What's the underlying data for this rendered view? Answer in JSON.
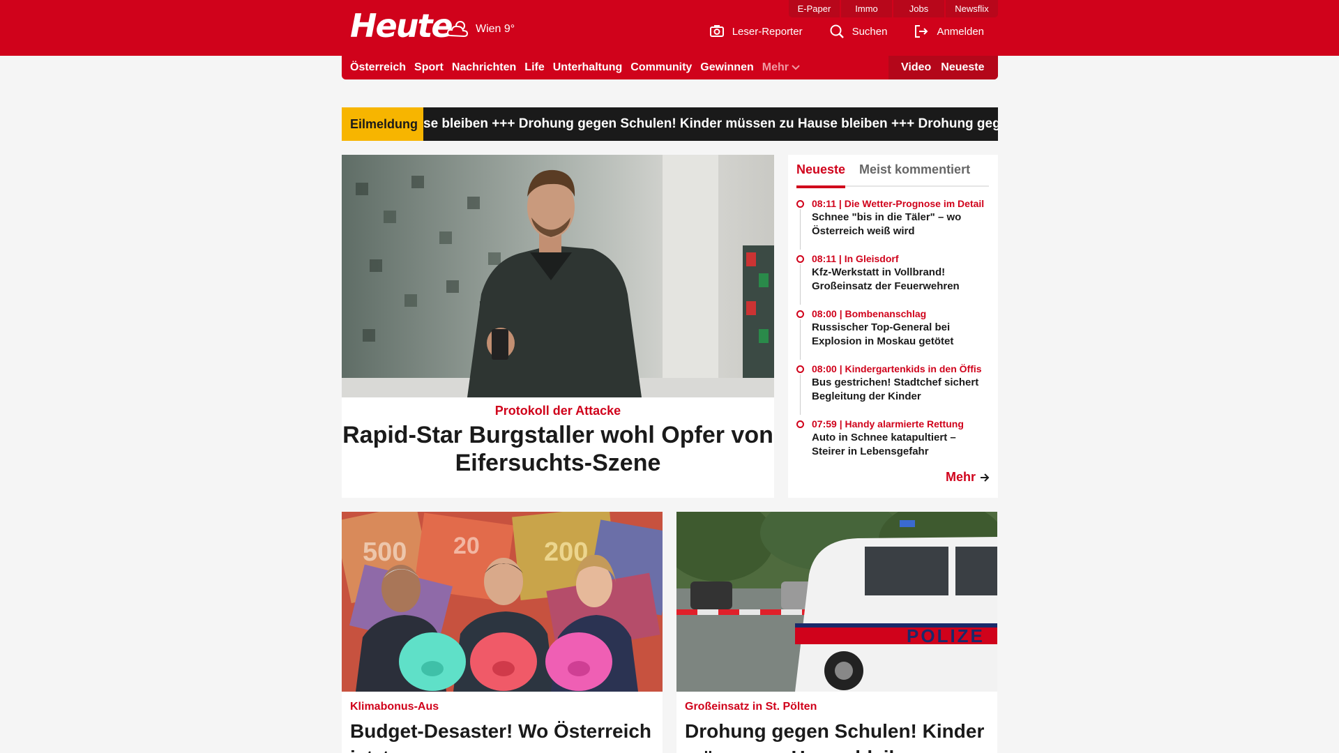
{
  "header": {
    "logo": "Heute",
    "weather": "Wien 9°",
    "utility_links": [
      "E-Paper",
      "Immo",
      "Jobs",
      "Newsflix"
    ],
    "actions": [
      {
        "label": "Leser-Reporter",
        "icon": "camera-icon"
      },
      {
        "label": "Suchen",
        "icon": "search-icon"
      },
      {
        "label": "Anmelden",
        "icon": "login-icon"
      }
    ]
  },
  "nav": {
    "items": [
      "Österreich",
      "Sport",
      "Nachrichten",
      "Life",
      "Unterhaltung",
      "Community",
      "Gewinnen"
    ],
    "more": "Mehr",
    "right": [
      "Video",
      "Neueste"
    ]
  },
  "ticker": {
    "label": "Eilmeldung",
    "text": "se bleiben   +++  Drohung gegen Schulen! Kinder müssen zu Hause bleiben   +++  Drohung gegen Schulen! Kinder müssen zu Hause bleiben"
  },
  "hero": {
    "kicker": "Protokoll der Attacke",
    "title": "Rapid-Star Burgstaller wohl Opfer von Eifersuchts-Szene"
  },
  "latest": {
    "tabs": [
      "Neueste",
      "Meist kommentiert"
    ],
    "items": [
      {
        "meta": "08:11 | Die Wetter-Prognose im Detail",
        "title": "Schnee \"bis in die Täler\" – wo Österreich weiß wird"
      },
      {
        "meta": "08:11 | In Gleisdorf",
        "title": "Kfz-Werkstatt in Vollbrand! Großeinsatz der Feuerwehren"
      },
      {
        "meta": "08:00 | Bombenanschlag",
        "title": "Russischer Top-General bei Explosion in Moskau getötet"
      },
      {
        "meta": "08:00 | Kindergartenkids in den Öffis",
        "title": "Bus gestrichen! Stadtchef sichert Begleitung der Kinder"
      },
      {
        "meta": "07:59 | Handy alarmierte Rettung",
        "title": "Auto in Schnee katapultiert – Steirer in Lebensgefahr"
      }
    ],
    "more": "Mehr"
  },
  "cards": [
    {
      "kicker": "Klimabonus-Aus",
      "title": "Budget-Desaster! Wo Österreich jetzt sparen muss"
    },
    {
      "kicker": "Großeinsatz in St. Pölten",
      "title": "Drohung gegen Schulen! Kinder müssen zu Hause bleiben",
      "image_text": "POLIZE"
    }
  ],
  "colors": {
    "brand": "#d0021b",
    "brand_dark": "#b4071a",
    "ticker_label": "#f7b500",
    "ticker_bg": "#1a1a1a"
  }
}
